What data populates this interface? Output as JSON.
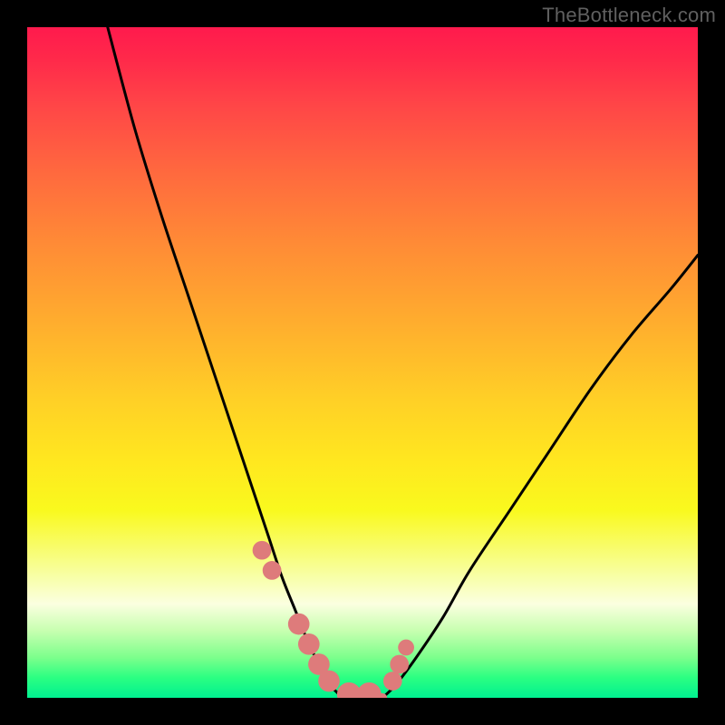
{
  "watermark": "TheBottleneck.com",
  "chart_data": {
    "type": "line",
    "title": "",
    "xlabel": "",
    "ylabel": "",
    "xlim": [
      0,
      100
    ],
    "ylim": [
      0,
      100
    ],
    "series": [
      {
        "name": "left-curve",
        "x": [
          12,
          16,
          20,
          24,
          28,
          32,
          34,
          36,
          38,
          40,
          42,
          43,
          44,
          45,
          46,
          47
        ],
        "values": [
          100,
          85,
          72,
          60,
          48,
          36,
          30,
          24,
          18,
          13,
          8,
          6,
          4,
          2,
          1,
          0
        ]
      },
      {
        "name": "right-curve",
        "x": [
          53,
          55,
          58,
          62,
          66,
          72,
          78,
          84,
          90,
          96,
          100
        ],
        "values": [
          0,
          2,
          6,
          12,
          19,
          28,
          37,
          46,
          54,
          61,
          66
        ]
      },
      {
        "name": "floor-flat",
        "x": [
          47,
          53
        ],
        "values": [
          0,
          0
        ]
      }
    ],
    "markers": {
      "name": "bottom-lobes",
      "color": "#de7b7b",
      "items": [
        {
          "cx": 35.0,
          "cy": 22.0,
          "r": 1.4
        },
        {
          "cx": 36.5,
          "cy": 19.0,
          "r": 1.4
        },
        {
          "cx": 40.5,
          "cy": 11.0,
          "r": 1.6
        },
        {
          "cx": 42.0,
          "cy": 8.0,
          "r": 1.6
        },
        {
          "cx": 43.5,
          "cy": 5.0,
          "r": 1.6
        },
        {
          "cx": 45.0,
          "cy": 2.5,
          "r": 1.6
        },
        {
          "cx": 48.0,
          "cy": 0.5,
          "r": 1.8
        },
        {
          "cx": 51.0,
          "cy": 0.5,
          "r": 1.8
        },
        {
          "cx": 54.5,
          "cy": 2.5,
          "r": 1.4
        },
        {
          "cx": 55.5,
          "cy": 5.0,
          "r": 1.4
        },
        {
          "cx": 56.5,
          "cy": 7.5,
          "r": 1.2
        }
      ]
    }
  }
}
